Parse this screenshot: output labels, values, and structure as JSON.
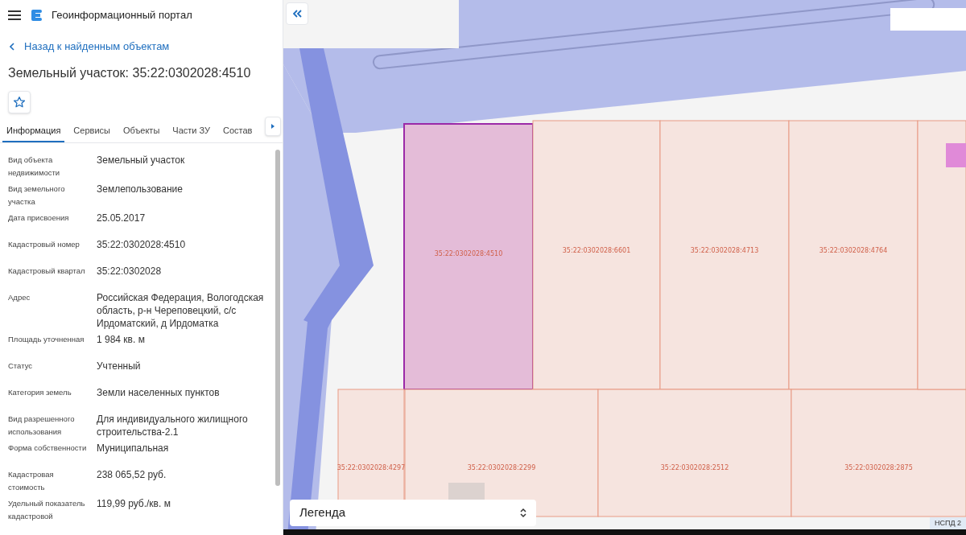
{
  "header": {
    "title": "Геоинформационный портал"
  },
  "back_link": "Назад к найденным объектам",
  "object_title": "Земельный участок: 35:22:0302028:4510",
  "favorite": {
    "selected": false
  },
  "tabs": [
    {
      "label": "Информация",
      "selected": true
    },
    {
      "label": "Сервисы",
      "selected": false
    },
    {
      "label": "Объекты",
      "selected": false
    },
    {
      "label": "Части ЗУ",
      "selected": false
    },
    {
      "label": "Состав",
      "selected": false
    }
  ],
  "properties": [
    {
      "label": "Вид объекта недвижимости",
      "value": "Земельный участок"
    },
    {
      "label": "Вид земельного участка",
      "value": "Землепользование"
    },
    {
      "label": "Дата присвоения",
      "value": "25.05.2017"
    },
    {
      "label": "Кадастровый номер",
      "value": "35:22:0302028:4510"
    },
    {
      "label": "Кадастровый квартал",
      "value": "35:22:0302028"
    },
    {
      "label": "Адрес",
      "value": "Российская Федерация, Вологодская область, р-н Череповецкий, с/с Ирдоматский, д Ирдоматка"
    },
    {
      "label": "Площадь уточненная",
      "value": "1 984 кв. м"
    },
    {
      "label": "Статус",
      "value": "Учтенный"
    },
    {
      "label": "Категория земель",
      "value": "Земли населенных пунктов"
    },
    {
      "label": "Вид разрешенного использования",
      "value": "Для индивидуального жилищного строительства-2.1"
    },
    {
      "label": "Форма собственности",
      "value": "Муниципальная"
    },
    {
      "label": "Кадастровая стоимость",
      "value": "238 065,52 руб."
    },
    {
      "label": "Удельный показатель кадастровой",
      "value": "119,99 руб./кв. м"
    }
  ],
  "map": {
    "parcels": [
      {
        "label": "35:22:0302028:4510",
        "selected": true
      },
      {
        "label": "35:22:0302028:6601",
        "selected": false
      },
      {
        "label": "35:22:0302028:4713",
        "selected": false
      },
      {
        "label": "35:22:0302028:4764",
        "selected": false
      },
      {
        "label": "35:22:0302028:4297",
        "selected": false
      },
      {
        "label": "35:22:0302028:2299",
        "selected": false
      },
      {
        "label": "35:22:0302028:2512",
        "selected": false
      },
      {
        "label": "35:22:0302028:2875",
        "selected": false
      }
    ],
    "legend": "Легенда",
    "attribution": "НСПД 2"
  }
}
